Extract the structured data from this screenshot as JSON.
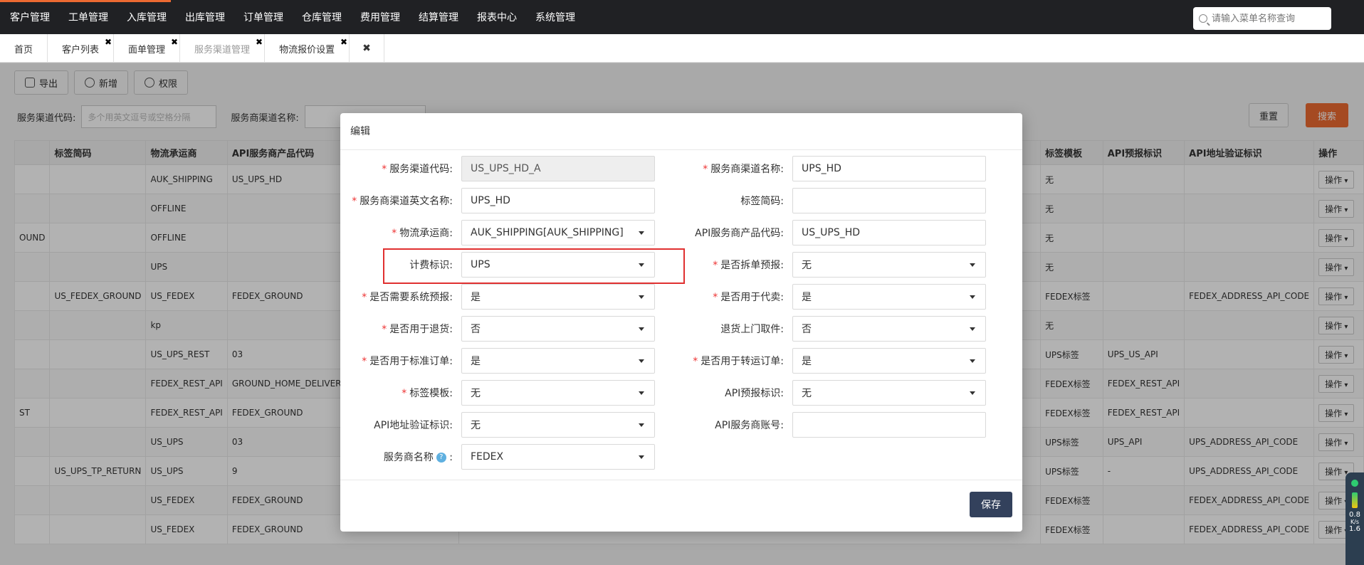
{
  "top_menu": [
    "客户管理",
    "工单管理",
    "入库管理",
    "出库管理",
    "订单管理",
    "仓库管理",
    "费用管理",
    "结算管理",
    "报表中心",
    "系统管理"
  ],
  "search": {
    "placeholder": "请输入菜单名称查询"
  },
  "tabs": [
    {
      "label": "首页",
      "closable": false
    },
    {
      "label": "客户列表",
      "closable": true
    },
    {
      "label": "面单管理",
      "closable": true
    },
    {
      "label": "服务渠道管理",
      "closable": true,
      "active": true
    },
    {
      "label": "物流报价设置",
      "closable": true
    }
  ],
  "tab_close_all": "✖",
  "toolbar": {
    "export": "导出",
    "add": "新增",
    "permission": "权限"
  },
  "filters": {
    "code_label": "服务渠道代码:",
    "code_placeholder": "多个用英文逗号或空格分隔",
    "name_label": "服务商渠道名称:",
    "reset": "重置",
    "search": "搜索"
  },
  "table": {
    "headers": [
      "",
      "标签简码",
      "物流承运商",
      "API服务商产品代码",
      "标签模板",
      "API预报标识",
      "API地址验证标识",
      "操作"
    ],
    "op_label": "操作",
    "rows": [
      [
        "",
        "",
        "AUK_SHIPPING",
        "US_UPS_HD",
        "无",
        "",
        ""
      ],
      [
        "",
        "",
        "OFFLINE",
        "",
        "无",
        "",
        ""
      ],
      [
        "OUND",
        "",
        "OFFLINE",
        "",
        "无",
        "",
        ""
      ],
      [
        "",
        "",
        "UPS",
        "",
        "无",
        "",
        ""
      ],
      [
        "",
        "US_FEDEX_GROUND",
        "US_FEDEX",
        "FEDEX_GROUND",
        "FEDEX标签",
        "",
        "FEDEX_ADDRESS_API_CODE"
      ],
      [
        "",
        "",
        "kp",
        "",
        "无",
        "",
        ""
      ],
      [
        "",
        "",
        "US_UPS_REST",
        "03",
        "UPS标签",
        "UPS_US_API",
        ""
      ],
      [
        "",
        "",
        "FEDEX_REST_API",
        "GROUND_HOME_DELIVERY",
        "FEDEX标签",
        "FEDEX_REST_API",
        ""
      ],
      [
        "ST",
        "",
        "FEDEX_REST_API",
        "FEDEX_GROUND",
        "FEDEX标签",
        "FEDEX_REST_API",
        ""
      ],
      [
        "",
        "",
        "US_UPS",
        "03",
        "UPS标签",
        "UPS_API",
        "UPS_ADDRESS_API_CODE"
      ],
      [
        "",
        "US_UPS_TP_RETURN",
        "US_UPS",
        "9",
        "UPS标签",
        "-",
        "UPS_ADDRESS_API_CODE"
      ],
      [
        "",
        "",
        "US_FEDEX",
        "FEDEX_GROUND",
        "FEDEX标签",
        "",
        "FEDEX_ADDRESS_API_CODE"
      ],
      [
        "",
        "",
        "US_FEDEX",
        "FEDEX_GROUND",
        "FEDEX标签",
        "",
        "FEDEX_ADDRESS_API_CODE"
      ]
    ]
  },
  "modal": {
    "title": "编辑",
    "save": "保存",
    "fields": {
      "channel_code": {
        "label": "服务渠道代码:",
        "value": "US_UPS_HD_A",
        "required": true
      },
      "provider_channel_name": {
        "label": "服务商渠道名称:",
        "value": "UPS_HD",
        "required": true
      },
      "provider_channel_en": {
        "label": "服务商渠道英文名称:",
        "value": "UPS_HD",
        "required": true
      },
      "label_code": {
        "label": "标签简码:",
        "value": ""
      },
      "carrier": {
        "label": "物流承运商:",
        "value": "AUK_SHIPPING[AUK_SHIPPING]",
        "required": true
      },
      "api_product_code": {
        "label": "API服务商产品代码:",
        "value": "US_UPS_HD"
      },
      "billing_flag": {
        "label": "计费标识:",
        "value": "UPS"
      },
      "split_forecast": {
        "label": "是否拆单预报:",
        "value": "无",
        "required": true
      },
      "system_forecast": {
        "label": "是否需要系统预报:",
        "value": "是",
        "required": true
      },
      "for_agent_sale": {
        "label": "是否用于代卖:",
        "value": "是",
        "required": true
      },
      "for_return": {
        "label": "是否用于退货:",
        "value": "否",
        "required": true
      },
      "return_pickup": {
        "label": "退货上门取件:",
        "value": "否"
      },
      "for_standard_order": {
        "label": "是否用于标准订单:",
        "value": "是",
        "required": true
      },
      "for_transfer_order": {
        "label": "是否用于转运订单:",
        "value": "是",
        "required": true
      },
      "label_template": {
        "label": "标签模板:",
        "value": "无",
        "required": true
      },
      "api_forecast_flag": {
        "label": "API预报标识:",
        "value": "无"
      },
      "api_address_flag": {
        "label": "API地址验证标识:",
        "value": "无"
      },
      "api_account": {
        "label": "API服务商账号:",
        "value": ""
      },
      "provider_name": {
        "label": "服务商名称",
        "value": "FEDEX",
        "help": "?"
      }
    }
  },
  "side_widget": {
    "v1": "0.8",
    "unit": "K/s",
    "v2": "1.6"
  }
}
